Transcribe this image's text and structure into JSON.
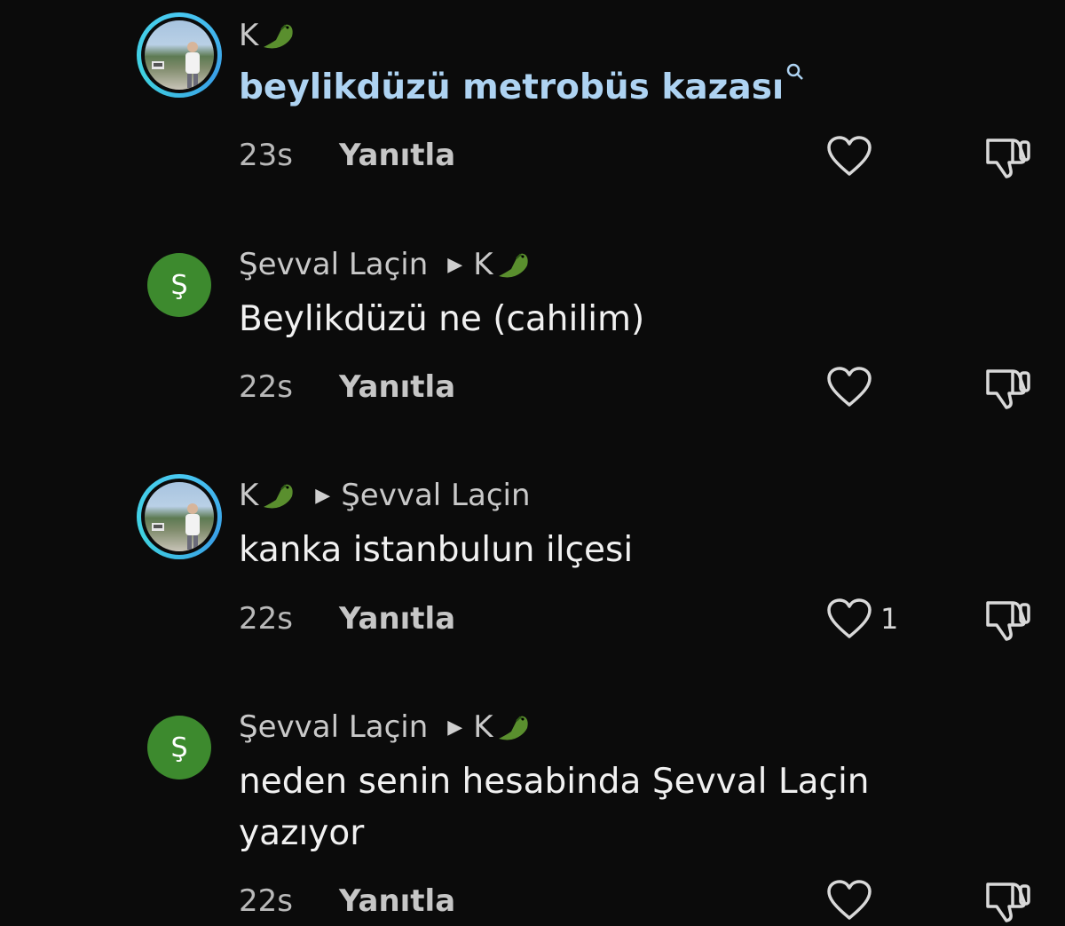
{
  "comments": [
    {
      "author": "K",
      "reply_to": "",
      "text": "beylikdüzü metrobüs kazası",
      "time": "23s",
      "reply_label": "Yanıtla",
      "likes": "",
      "avatar": "photo"
    },
    {
      "author": "Şevval Laçin",
      "reply_to": "K",
      "text": "Beylikdüzü ne (cahilim)",
      "time": "22s",
      "reply_label": "Yanıtla",
      "likes": "",
      "avatar_letter": "Ş"
    },
    {
      "author": "K",
      "reply_to": "Şevval Laçin",
      "text": "kanka istanbulun ilçesi",
      "time": "22s",
      "reply_label": "Yanıtla",
      "likes": "1",
      "avatar": "photo"
    },
    {
      "author": "Şevval Laçin",
      "reply_to": "K",
      "text_line1": "neden senin hesabinda Şevval Laçin",
      "text_line2": "yazıyor",
      "time": "22s",
      "reply_label": "Yanıtla",
      "likes": "",
      "avatar_letter": "Ş"
    }
  ],
  "icons": {
    "like": "heart-outline-icon",
    "dislike": "thumbs-down-outline-icon",
    "reply_arrow": "triangle-right-icon",
    "emoji": "crocodile-emoji",
    "search_hint": "search-icon"
  },
  "colors": {
    "background": "#0b0b0b",
    "link_text": "#aed3f2",
    "avatar_green": "#3d8a2e",
    "story_ring": "#49c9f2"
  }
}
